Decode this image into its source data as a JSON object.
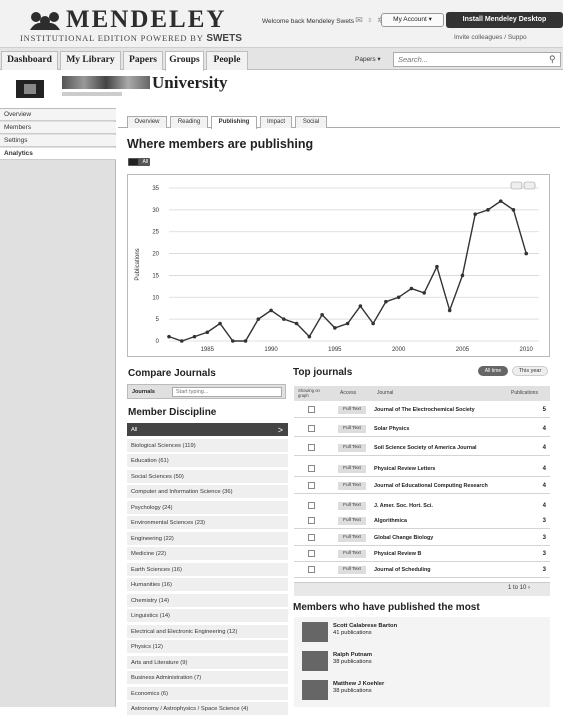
{
  "header": {
    "logo_text": "MENDELEY",
    "logo_sub_prefix": "INSTITUTIONAL EDITION POWERED BY",
    "logo_sub_brand": "SWETS",
    "welcome": "Welcome back Mendeley Swets",
    "my_account": "My Account",
    "install": "Install Mendeley Desktop",
    "invite": "Invite colleagues / Suppo"
  },
  "nav": {
    "tabs": [
      "Dashboard",
      "My Library",
      "Papers",
      "Groups",
      "People"
    ],
    "active_tab": "Groups",
    "search_scope": "Papers",
    "search_placeholder": "Search..."
  },
  "group": {
    "name": "University"
  },
  "sidebar": {
    "items": [
      "Overview",
      "Members",
      "Settings",
      "Analytics"
    ],
    "active": "Analytics"
  },
  "content": {
    "tabs": [
      "Overview",
      "Reading",
      "Publishing",
      "Impact",
      "Social"
    ],
    "active_tab": "Publishing",
    "title": "Where members are publishing",
    "toggle_label": "All"
  },
  "chart_data": {
    "type": "line",
    "ylabel": "Publications",
    "ylim": [
      0,
      35
    ],
    "yticks": [
      0,
      5,
      10,
      15,
      20,
      25,
      30,
      35
    ],
    "xticks": [
      1985,
      1990,
      1995,
      2000,
      2005,
      2010
    ],
    "x": [
      1982,
      1983,
      1984,
      1985,
      1986,
      1987,
      1988,
      1989,
      1990,
      1991,
      1992,
      1993,
      1994,
      1995,
      1996,
      1997,
      1998,
      1999,
      2000,
      2001,
      2002,
      2003,
      2004,
      2005,
      2006,
      2007,
      2008,
      2009,
      2010,
      2011
    ],
    "values": [
      1,
      0,
      1,
      2,
      4,
      0,
      0,
      5,
      7,
      5,
      4,
      1,
      6,
      3,
      4,
      8,
      4,
      9,
      10,
      12,
      11,
      17,
      7,
      15,
      29,
      30,
      32,
      30,
      20
    ],
    "grid": true,
    "color": "#333333"
  },
  "compare": {
    "title": "Compare Journals",
    "label": "Journals",
    "placeholder": "Start typing..."
  },
  "discipline": {
    "title": "Member Discipline",
    "items": [
      "All",
      "Biological Sciences (119)",
      "Education (61)",
      "Social Sciences (50)",
      "Computer and Information Science (36)",
      "Psychology (24)",
      "Environmental Sciences (23)",
      "Engineering (22)",
      "Medicine (22)",
      "Earth Sciences (16)",
      "Humanities (16)",
      "Chemistry (14)",
      "Linguistics (14)",
      "Electrical and Electronic Engineering (12)",
      "Physics (12)",
      "Arts and Literature (9)",
      "Business Administration (7)",
      "Economics (6)",
      "Astronomy / Astrophysics / Space Science (4)"
    ],
    "active": "All"
  },
  "top_journals": {
    "title": "Top journals",
    "all_time": "All time",
    "this_year": "This year",
    "headers": [
      "Showing on graph",
      "Access",
      "Journal",
      "Publications"
    ],
    "access_label": "Full Text",
    "rows": [
      {
        "journal": "Journal of The Electrochemical Society",
        "count": "5"
      },
      {
        "journal": "Solar Physics",
        "count": "4"
      },
      {
        "journal": "Soil Science Society of America Journal",
        "count": "4"
      },
      {
        "journal": "Physical Review Letters",
        "count": "4"
      },
      {
        "journal": "Journal of Educational Computing Research",
        "count": "4"
      },
      {
        "journal": "J. Amer. Soc. Hort. Sci.",
        "count": "4"
      },
      {
        "journal": "Algorithmica",
        "count": "3"
      },
      {
        "journal": "Global Change Biology",
        "count": "3"
      },
      {
        "journal": "Physical Review B",
        "count": "3"
      },
      {
        "journal": "Journal of Scheduling",
        "count": "3"
      }
    ],
    "pager": "1 to 10"
  },
  "members": {
    "title": "Members who have published the most",
    "list": [
      {
        "name": "Scott Calabrese Barton",
        "pubs": "41 publications"
      },
      {
        "name": "Ralph Putnam",
        "pubs": "38 publications"
      },
      {
        "name": "Matthew J Koehler",
        "pubs": "38 publications"
      }
    ]
  }
}
